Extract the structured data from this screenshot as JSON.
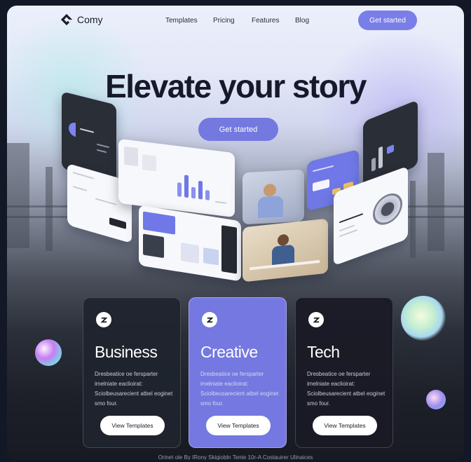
{
  "header": {
    "brand": "Comy",
    "nav": [
      "Templates",
      "Pricing",
      "Features",
      "Blog"
    ],
    "cta": "Get started"
  },
  "hero": {
    "title": "Elevate your story",
    "cta": "Get started"
  },
  "cards": [
    {
      "title": "Business",
      "description": "Dresbeatice oe fersparter imelniate eaclioirat: Sciolbeusarecient atbel eoginet smo four.",
      "button": "View Templates"
    },
    {
      "title": "Creative",
      "description": "Dresbeatice oe fersparter imelniate eaclioirat: Sciolbeusarecient atbel eoginet smo four.",
      "button": "View Templates"
    },
    {
      "title": "Tech",
      "description": "Dresbeatice oe fersparter imelniate eaclioirat: Sciolbeusarecient atbel eoginet smo four.",
      "button": "View Templates"
    }
  ],
  "footer": "Orinet ole By IRony Skigiobln Tente 10r-A Costauirer Ulinaices",
  "colors": {
    "accent": "#7479e0",
    "card_dark": "#1e242e",
    "card_purple": "#7478e0",
    "title": "#17192a"
  },
  "icons": {
    "brand": "logo-mark-icon",
    "card": "arrow-badge-icon"
  }
}
